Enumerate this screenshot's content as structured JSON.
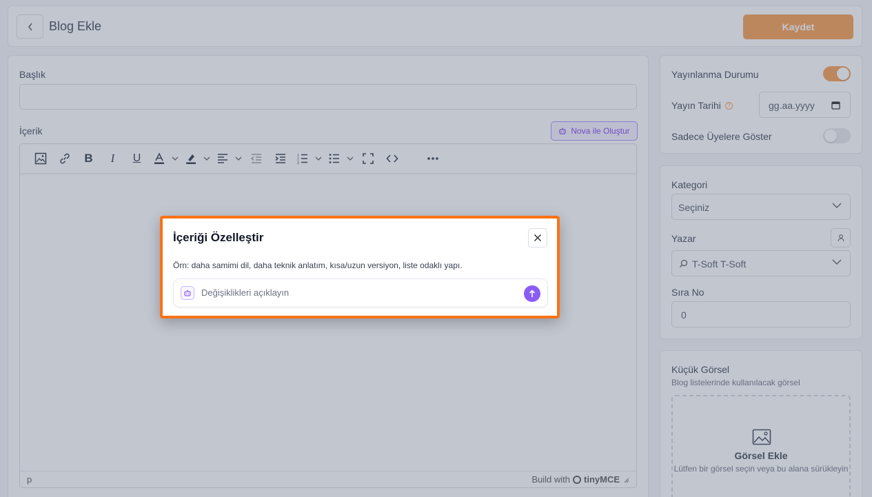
{
  "header": {
    "title": "Blog Ekle",
    "save_label": "Kaydet"
  },
  "main": {
    "title_label": "Başlık",
    "title_value": "",
    "content_label": "İçerik",
    "nova_button": "Nova ile Oluştur",
    "editor": {
      "toolbar": [
        "image-icon",
        "link-icon",
        "bold-icon",
        "italic-icon",
        "underline-icon",
        "text-color-icon",
        "highlight-icon",
        "align-icon",
        "outdent-icon",
        "indent-icon",
        "numbered-list-icon",
        "bullet-list-icon",
        "fullscreen-icon",
        "code-icon",
        "more-icon"
      ],
      "status_path": "p",
      "branding_prefix": "Build with",
      "branding_name": "tinyMCE"
    }
  },
  "publish": {
    "status_label": "Yayınlanma Durumu",
    "status_on": true,
    "date_label": "Yayın Tarihi",
    "date_placeholder": "gg.aa.yyyy",
    "members_label": "Sadece Üyelere Göster",
    "members_on": false
  },
  "meta": {
    "category_label": "Kategori",
    "category_value": "Seçiniz",
    "author_label": "Yazar",
    "author_value": "T-Soft T-Soft",
    "order_label": "Sıra No",
    "order_value": "0"
  },
  "thumbnail": {
    "title": "Küçük Görsel",
    "subtitle": "Blog listelerinde kullanılacak görsel",
    "add_label": "Görsel Ekle",
    "add_hint": "Lütfen bir görsel seçin veya bu alana sürükleyin"
  },
  "modal": {
    "title": "İçeriği Özelleştir",
    "hint": "Örn: daha samimi dil, daha teknik anlatım, kısa/uzun versiyon, liste odaklı yapı.",
    "input_placeholder": "Değişiklikleri açıklayın"
  },
  "colors": {
    "accent_orange": "#f79a4a",
    "modal_border": "#f97316",
    "nova_purple": "#8b5cf6"
  }
}
